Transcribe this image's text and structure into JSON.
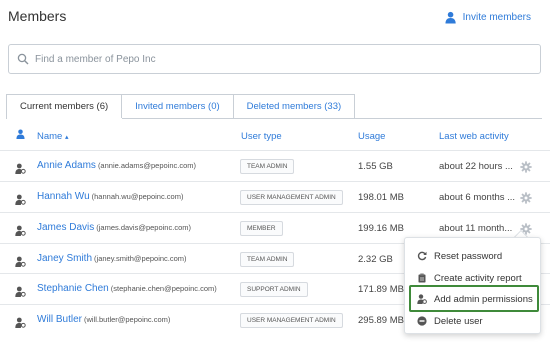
{
  "header": {
    "title": "Members",
    "invite_label": "Invite members"
  },
  "search": {
    "placeholder": "Find a member of Pepo Inc"
  },
  "tabs": [
    {
      "label": "Current members (6)",
      "active": true
    },
    {
      "label": "Invited members (0)",
      "active": false
    },
    {
      "label": "Deleted members (33)",
      "active": false
    }
  ],
  "table": {
    "headers": {
      "name": "Name",
      "sort_indicator": "▴",
      "user_type": "User type",
      "usage": "Usage",
      "last_activity": "Last web activity"
    },
    "rows": [
      {
        "name": "Annie Adams",
        "email": "(annie.adams@pepoinc.com)",
        "type": "TEAM ADMIN",
        "usage": "1.55 GB",
        "activity": "about 22 hours ..."
      },
      {
        "name": "Hannah Wu",
        "email": "(hannah.wu@pepoinc.com)",
        "type": "USER MANAGEMENT ADMIN",
        "usage": "198.01 MB",
        "activity": "about 6 months ..."
      },
      {
        "name": "James Davis",
        "email": "(james.davis@pepoinc.com)",
        "type": "MEMBER",
        "usage": "199.16 MB",
        "activity": "about 11 month..."
      },
      {
        "name": "Janey Smith",
        "email": "(janey.smith@pepoinc.com)",
        "type": "TEAM ADMIN",
        "usage": "2.32 GB",
        "activity": ""
      },
      {
        "name": "Stephanie Chen",
        "email": "(stephanie.chen@pepoinc.com)",
        "type": "SUPPORT ADMIN",
        "usage": "171.89 MB",
        "activity": ""
      },
      {
        "name": "Will Butler",
        "email": "(will.butler@pepoinc.com)",
        "type": "USER MANAGEMENT ADMIN",
        "usage": "295.89 MB",
        "activity": ""
      }
    ]
  },
  "menu": {
    "items": [
      {
        "label": "Reset password",
        "icon": "refresh-icon"
      },
      {
        "label": "Create activity report",
        "icon": "clipboard-icon"
      },
      {
        "label": "Add admin permissions",
        "icon": "user-admin-icon"
      },
      {
        "label": "Delete user",
        "icon": "minus-circle-icon"
      }
    ]
  },
  "colors": {
    "accent": "#2f7bd9",
    "highlight": "#3f8a3a"
  }
}
